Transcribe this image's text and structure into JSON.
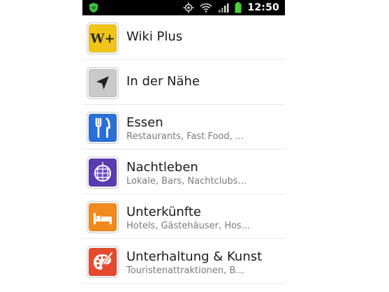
{
  "status_bar": {
    "time": "12:50",
    "icons": [
      "shield-icon",
      "gps-icon",
      "wifi-icon",
      "signal-icon",
      "battery-icon"
    ]
  },
  "items": [
    {
      "title": "Wiki Plus",
      "subtitle": "",
      "icon": "wiki-plus-icon",
      "color": "#f0c419"
    },
    {
      "title": "In der Nähe",
      "subtitle": "",
      "icon": "navigation-arrow-icon",
      "color": "#c9c9c9"
    },
    {
      "title": "Essen",
      "subtitle": "Restaurants, Fast Food, ...",
      "icon": "fork-knife-icon",
      "color": "#2a6fd6"
    },
    {
      "title": "Nachtleben",
      "subtitle": "Lokale, Bars, Nachtclubs...",
      "icon": "disco-ball-icon",
      "color": "#5b3bb0"
    },
    {
      "title": "Unterkünfte",
      "subtitle": "Hotels, Gästehäuser, Hos...",
      "icon": "bed-icon",
      "color": "#f08a1c"
    },
    {
      "title": "Unterhaltung & Kunst",
      "subtitle": "Touristenattraktionen, B...",
      "icon": "palette-icon",
      "color": "#e64a2e"
    }
  ],
  "labels": {
    "wiki_logo": "W+"
  }
}
